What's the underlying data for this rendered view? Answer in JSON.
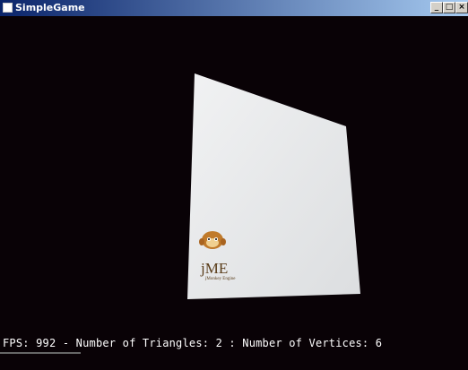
{
  "window": {
    "title": "SimpleGame"
  },
  "titlebar_buttons": {
    "minimize": "_",
    "maximize": "□",
    "close": "×"
  },
  "scene": {
    "hud_text": "FPS: 992 - Number of Triangles: 2 : Number of Vertices: 6",
    "logo": {
      "text": "jME",
      "subtext": "jMonkey Engine"
    }
  },
  "colors": {
    "background": "#090206",
    "quad": "#e8eaec",
    "hud": "#ffffff"
  }
}
